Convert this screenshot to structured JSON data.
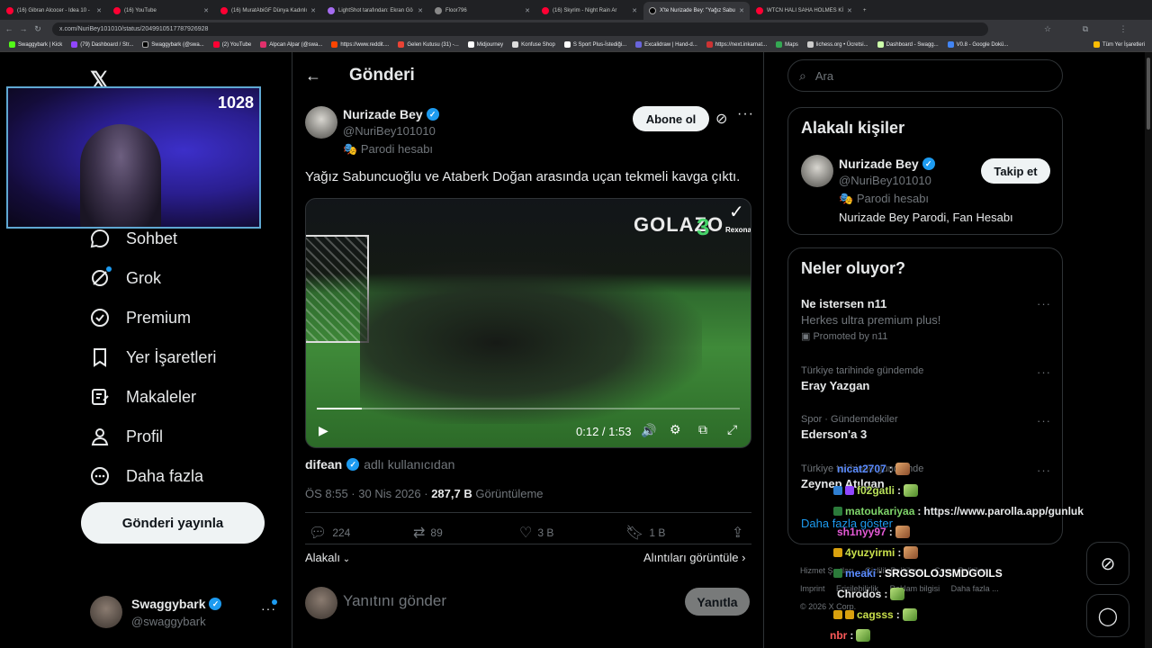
{
  "browser": {
    "tabs": [
      {
        "label": "(16) Gibran Alcocer - Idea 10 -"
      },
      {
        "label": "(16) YouTube"
      },
      {
        "label": "(16) MuratAbiGF Dünya Kadınlı"
      },
      {
        "label": "LightShot tarafından: Ekran Gö"
      },
      {
        "label": "Floor796"
      },
      {
        "label": "(16) Skyrim - Night Rain Ar"
      },
      {
        "label": "X'te Nurizade Bey: \"Yağız Sabu"
      },
      {
        "label": "WTCN HALI SAHA HOLMES Kİ"
      }
    ],
    "url": "x.com/NuriBey101010/status/2049910517787926928",
    "bookmarks": [
      "Swaggybark | Kick",
      "(79) Dashboard / Str...",
      "Swaggybark (@swa...",
      "(2) YouTube",
      "Alpcan Alpar (@swa...",
      "https://www.reddit....",
      "Gelen Kutusu (31) -...",
      "Midjourney",
      "Konfuse Shop",
      "S Sport Plus-İstediği...",
      "Excalidraw | Hand-d...",
      "https://next.inkarnat...",
      "Maps",
      "lichess.org • Ücretsi...",
      "Dashboard - Swagg...",
      "V0.8 - Google Dokü...",
      "Tüm Yer İşaretleri"
    ]
  },
  "webcam": {
    "count": "1028"
  },
  "nav": {
    "items": [
      {
        "label": "Sohbet"
      },
      {
        "label": "Grok"
      },
      {
        "label": "Premium"
      },
      {
        "label": "Yer İşaretleri"
      },
      {
        "label": "Makaleler"
      },
      {
        "label": "Profil"
      },
      {
        "label": "Daha fazla"
      }
    ],
    "post_button": "Gönderi yayınla",
    "account": {
      "name": "Swaggybark",
      "handle": "@swaggybark"
    }
  },
  "post": {
    "header_title": "Gönderi",
    "author": {
      "name": "Nurizade Bey",
      "handle": "@NuriBey101010",
      "parody": "Parodi hesabı"
    },
    "follow_button": "Abone ol",
    "text": "Yağız Sabuncuoğlu ve Ataberk Doğan arasında uçan tekmeli kavga çıktı.",
    "video": {
      "time": "0:12 / 1:53",
      "progress_fraction": 0.106,
      "board_text": "GOLAZO",
      "board_number": "3",
      "sponsor": "Rexona"
    },
    "source": {
      "name": "difean",
      "suffix": "adlı kullanıcıdan"
    },
    "meta": {
      "time": "ÖS 8:55 · 30 Nis 2026 · ",
      "views": "287,7 B",
      "views_label": "Görüntüleme"
    },
    "actions": {
      "replies": "224",
      "reposts": "89",
      "likes": "3 B",
      "bookmarks": "1 B"
    },
    "relevant_label": "Alakalı",
    "quotes_label": "Alıntıları görüntüle",
    "reply_placeholder": "Yanıtını gönder",
    "reply_button": "Yanıtla"
  },
  "right": {
    "search_placeholder": "Ara",
    "related": {
      "title": "Alakalı kişiler",
      "name": "Nurizade Bey",
      "handle": "@NuriBey101010",
      "parody": "Parodi hesabı",
      "bio": "Nurizade Bey Parodi, Fan Hesabı",
      "follow_button": "Takip et"
    },
    "trends": {
      "title": "Neler oluyor?",
      "items": [
        {
          "meta": "",
          "title": "Ne istersen n11",
          "sub": "Herkes ultra premium plus!",
          "promo": "Promoted by n11"
        },
        {
          "meta": "Türkiye tarihinde gündemde",
          "title": "Eray Yazgan"
        },
        {
          "meta": "Spor · Gündemdekiler",
          "title": "Ederson'a 3"
        },
        {
          "meta": "Türkiye tarihinde gündemde",
          "title": "Zeynep Atılgan"
        }
      ],
      "show_more": "Daha fazla göster"
    },
    "footer": [
      "Hizmet Şartları",
      "Gizlilik Politikası",
      "Çerez Politikası",
      "Imprint",
      "Erişilebilirlik",
      "Reklam bilgisi",
      "Daha fazla ...",
      "© 2026 X Corp."
    ]
  },
  "chat": [
    {
      "user": "nicat2707",
      "color": "#5b8cff",
      "msg": ""
    },
    {
      "user": "f02gatli",
      "color": "#b8e05a",
      "msg": ""
    },
    {
      "user": "matoukariyaa",
      "color": "#7fd46a",
      "msg": "https://www.parolla.app/gunluk"
    },
    {
      "user": "sh1nyy97",
      "color": "#e45ad6",
      "msg": ""
    },
    {
      "user": "4yuzyirmi",
      "color": "#c9e04c",
      "msg": ""
    },
    {
      "user": "meaki",
      "color": "#5b8cff",
      "msg": "SRGSOLOJSMDGOILS"
    },
    {
      "user": "Chrodos",
      "color": "#e7e9ea",
      "msg": ""
    },
    {
      "user": "cagsss",
      "color": "#c9e04c",
      "msg": ""
    },
    {
      "user": "nbr",
      "color": "#ff5a5a",
      "msg": ""
    }
  ],
  "colors": {
    "accent": "#1d9bf0",
    "background": "#000000",
    "border": "#2f3336",
    "muted": "#71767b"
  }
}
